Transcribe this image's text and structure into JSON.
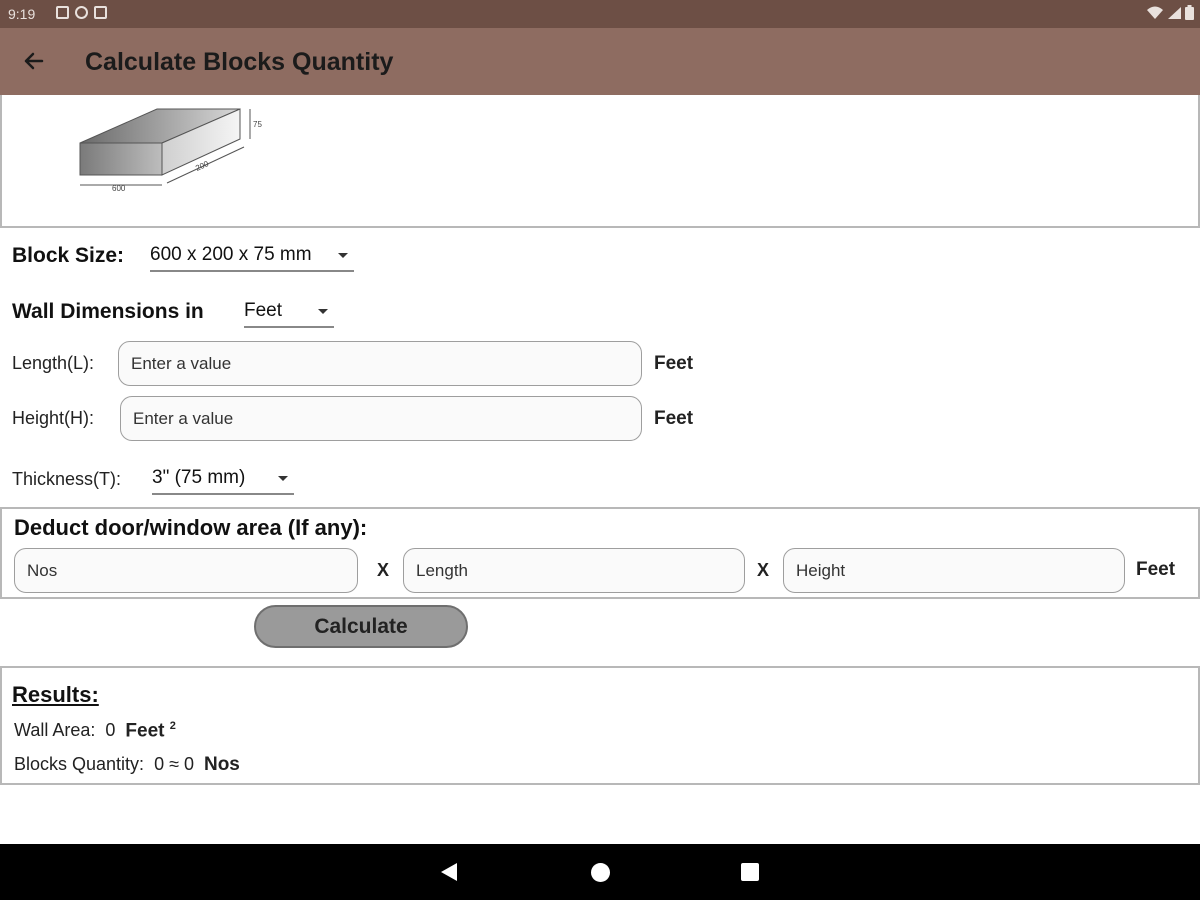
{
  "status_bar": {
    "time": "9:19"
  },
  "app_bar": {
    "title": "Calculate Blocks Quantity"
  },
  "block_image": {
    "dim_length": "600",
    "dim_width": "200",
    "dim_height": "75"
  },
  "block_size": {
    "label": "Block Size:",
    "value": "600 x 200 x 75 mm"
  },
  "wall_dimensions": {
    "label": "Wall Dimensions in",
    "unit_value": "Feet"
  },
  "length": {
    "label": "Length(L):",
    "placeholder": "Enter a value",
    "unit": "Feet"
  },
  "height": {
    "label": "Height(H):",
    "placeholder": "Enter a value",
    "unit": "Feet"
  },
  "thickness": {
    "label": "Thickness(T):",
    "value": "3\" (75 mm)"
  },
  "deduct": {
    "title": "Deduct door/window area (If any):",
    "nos_placeholder": "Nos",
    "length_placeholder": "Length",
    "height_placeholder": "Height",
    "times": "X",
    "unit": "Feet"
  },
  "calculate": {
    "label": "Calculate"
  },
  "results": {
    "title": "Results:",
    "wall_area_label": "Wall Area:",
    "wall_area_value": "0",
    "wall_area_unit": "Feet",
    "wall_area_sup": "2",
    "blocks_label": "Blocks Quantity:",
    "blocks_value": "0 ≈ 0",
    "blocks_unit": "Nos"
  },
  "colors": {
    "status_bar": "#6d4f45",
    "app_bar": "#8e6c61",
    "button": "#9a9a9a"
  },
  "icons": [
    "back-arrow-icon",
    "wifi-icon",
    "signal-icon",
    "battery-icon",
    "nav-back-icon",
    "nav-home-icon",
    "nav-recents-icon"
  ]
}
